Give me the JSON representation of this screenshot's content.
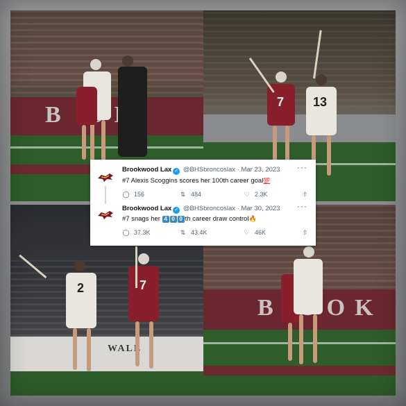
{
  "photo_wall_text": {
    "tl": "B  OK",
    "bl_banner": "WALL",
    "br": "B  OOK"
  },
  "jersey_numbers": {
    "tl": "",
    "tr_maroon": "7",
    "tr_white": "13",
    "bl_white": "2",
    "bl_maroon": "7"
  },
  "tweets": [
    {
      "name": "Brookwood Lax",
      "handle": "@BHSbroncoslax",
      "dot": "·",
      "date": "Mar 23, 2023",
      "more": "···",
      "body_text": "#7 Alexis Scoggins scores her 100th career goal",
      "body_emoji": "💯",
      "replies": "156",
      "retweets": "484",
      "likes": "2.3K"
    },
    {
      "name": "Brookwood Lax",
      "handle": "@BHSbroncoslax",
      "dot": "·",
      "date": "Mar 30, 2023",
      "more": "···",
      "body_prefix": "#7 snags her ",
      "body_digits": [
        "4",
        "0",
        "0"
      ],
      "body_suffix": "th career draw control",
      "body_emoji": "🔥",
      "replies": "37.3K",
      "retweets": "43.4K",
      "likes": "46K"
    }
  ],
  "icons": {
    "reply": "reply-icon",
    "retweet": "retweet-icon",
    "like": "heart-icon",
    "share": "share-icon",
    "verified": "verified-badge-icon",
    "logo": "bronco-logo-icon"
  },
  "colors": {
    "maroon": "#6a2731",
    "field": "#2e5c2a",
    "verified": "#1d9bf0"
  }
}
